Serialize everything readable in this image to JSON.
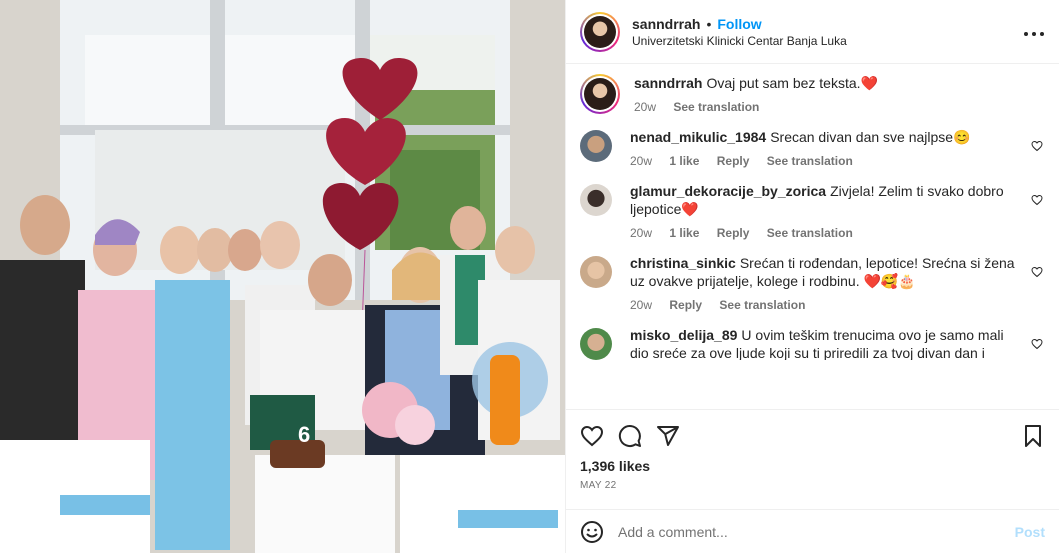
{
  "post": {
    "username": "sanndrrah",
    "separator": "•",
    "follow_label": "Follow",
    "location": "Univerzitetski Klinicki Centar Banja Luka",
    "more_label": "•••"
  },
  "caption": {
    "username": "sanndrrah",
    "text": "Ovaj put sam bez teksta.❤️",
    "time": "20w",
    "see_translation": "See translation"
  },
  "comments": [
    {
      "username": "nenad_mikulic_1984",
      "text": "Srecan divan dan sve najlpse😊",
      "time": "20w",
      "likes": "1 like",
      "reply": "Reply",
      "see_translation": "See translation"
    },
    {
      "username": "glamur_dekoracije_by_zorica",
      "text": "Zivjela! Zelim ti svako dobro ljepotice❤️",
      "time": "20w",
      "likes": "1 like",
      "reply": "Reply",
      "see_translation": "See translation"
    },
    {
      "username": "christina_sinkic",
      "text": "Srećan ti rođendan, lepotice! Srećna si žena uz ovakve prijatelje, kolege i rodbinu. ❤️🥰🎂",
      "time": "20w",
      "reply": "Reply",
      "see_translation": "See translation"
    },
    {
      "username": "misko_delija_89",
      "text": "U ovim teškim trenucima ovo je samo mali dio sreće za ove ljude koji su ti priredili za tvoj divan dan i naravno"
    }
  ],
  "footer": {
    "likes": "1,396 likes",
    "date": "MAY 22",
    "add_comment_placeholder": "Add a comment...",
    "post_label": "Post"
  },
  "icons": {
    "like": "heart-icon",
    "comment": "comment-icon",
    "share": "share-icon",
    "save": "bookmark-icon",
    "emoji": "emoji-icon"
  },
  "colors": {
    "follow": "#0095f6",
    "muted": "#737373",
    "post_disabled": "#b2dffc"
  },
  "photo": {
    "cake_candle_label": "6"
  }
}
